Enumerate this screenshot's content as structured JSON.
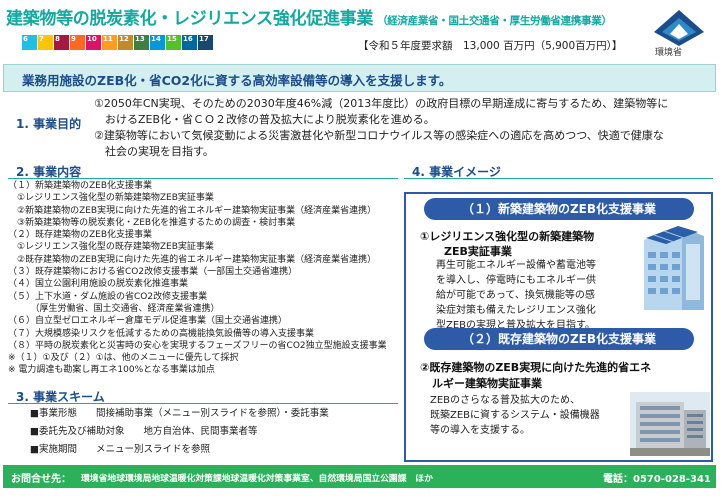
{
  "header": {
    "title": "建築物等の脱炭素化・レジリエンス強化促進事業",
    "ministries": "（経済産業省・国土交通省・厚生労働省連携事業）",
    "budget": "【令和５年度要求額　13,000 百万円（5,900百万円）】",
    "logo_text": "環境省"
  },
  "sdgs": [
    {
      "num": "6",
      "color": "#26BDE2"
    },
    {
      "num": "7",
      "color": "#FCC30B"
    },
    {
      "num": "8",
      "color": "#A21942"
    },
    {
      "num": "9",
      "color": "#FD6925"
    },
    {
      "num": "10",
      "color": "#DD1367"
    },
    {
      "num": "11",
      "color": "#FD9D24"
    },
    {
      "num": "12",
      "color": "#BF8B2E"
    },
    {
      "num": "13",
      "color": "#3F7E44"
    },
    {
      "num": "14",
      "color": "#0A97D9"
    },
    {
      "num": "15",
      "color": "#56C02B"
    },
    {
      "num": "16",
      "color": "#00689D"
    },
    {
      "num": "17",
      "color": "#19486A"
    }
  ],
  "banner": "業務用施設のZEB化・省CO2化に資する高効率設備等の導入を支援します。",
  "purpose": {
    "label": "1. 事業目的",
    "lines": [
      "①2050年CN実現、そのための2030年度46%減（2013年度比）の政府目標の早期達成に寄与するため、建築物等に",
      "　おけるZEB化・省ＣＯ２改修の普及拡大により脱炭素化を進める。",
      "②建築物等において気候変動による災害激甚化や新型コロナウイルス等の感染症への適応を高めつつ、快適で健康な",
      "　社会の実現を目指す。"
    ]
  },
  "content": {
    "label": "2. 事業内容",
    "lines": [
      "（１）新築建築物のZEB化支援事業",
      "　①レジリエンス強化型の新築建築物ZEB実証事業",
      "　②新築建築物のZEB実現に向けた先進的省エネルギー建築物実証事業（経済産業省連携）",
      "　③新築建築物等の脱炭素化・ZEB化を推進するための調査・検討事業",
      "（２）既存建築物のZEB化支援事業",
      "　①レジリエンス強化型の既存建築物ZEB実証事業",
      "　②既存建築物のZEB実現に向けた先進的省エネルギー建築物実証事業（経済産業省連携）",
      "（３）既存建築物における省CO2改修支援事業（一部国土交通省連携）",
      "（４）国立公園利用施設の脱炭素化推進事業",
      "（５）上下水道・ダム施設の省CO2改修支援事業",
      "　　　（厚生労働省、国土交通省、経済産業省連携）",
      "（６）自立型ゼロエネルギー倉庫モデル促進事業（国土交通省連携）",
      "（７）大規模感染リスクを低減するための高機能換気設備等の導入支援事業",
      "（８）平時の脱炭素化と災害時の安心を実現するフェーズフリーの省CO2独立型施設支援事業",
      "※（１）①及び（２）①は、他のメニューに優先して採択",
      "※ 電力調達も勘案し再エネ100%となる事業は加点"
    ]
  },
  "scheme": {
    "label": "3. 事業スキーム",
    "lines": [
      "■事業形態　　間接補助事業（メニュー別スライドを参照）・委託事業",
      "■委託先及び補助対象　　地方自治体、民間事業者等",
      "■実施期間　　メニュー別スライドを参照"
    ]
  },
  "image": {
    "label": "4. 事業イメージ",
    "pill1": "（１）新築建築物のZEB化支援事業",
    "item1_title_1": "①レジリエンス強化型の新築建築物",
    "item1_title_2": "ZEB実証事業",
    "item1_lines": [
      "再生可能エネルギー設備や蓄電池等",
      "を導入し、停電時にもエネルギー供",
      "給が可能であって、換気機能等の感",
      "染症対策も備えたレジリエンス強化",
      "型ZEBの実現と普及拡大を目指す。"
    ],
    "pill2": "（２）既存建築物のZEB化支援事業",
    "item2_title_1": "②既存建築物のZEB実現に向けた先進的省エネ",
    "item2_title_2": "ルギー建築物実証事業",
    "item2_lines": [
      "ZEBのさらなる普及拡大のため、",
      "既築ZEBに資するシステム・設備機器",
      "等の導入を支援する。"
    ]
  },
  "footer": {
    "label": "お問合せ先：",
    "contact": "環境省地球環境局地球温暖化対策課地球温暖化対策事業室、自然環境局国立公園課　ほか",
    "phone": "電話：0570-028-341"
  }
}
